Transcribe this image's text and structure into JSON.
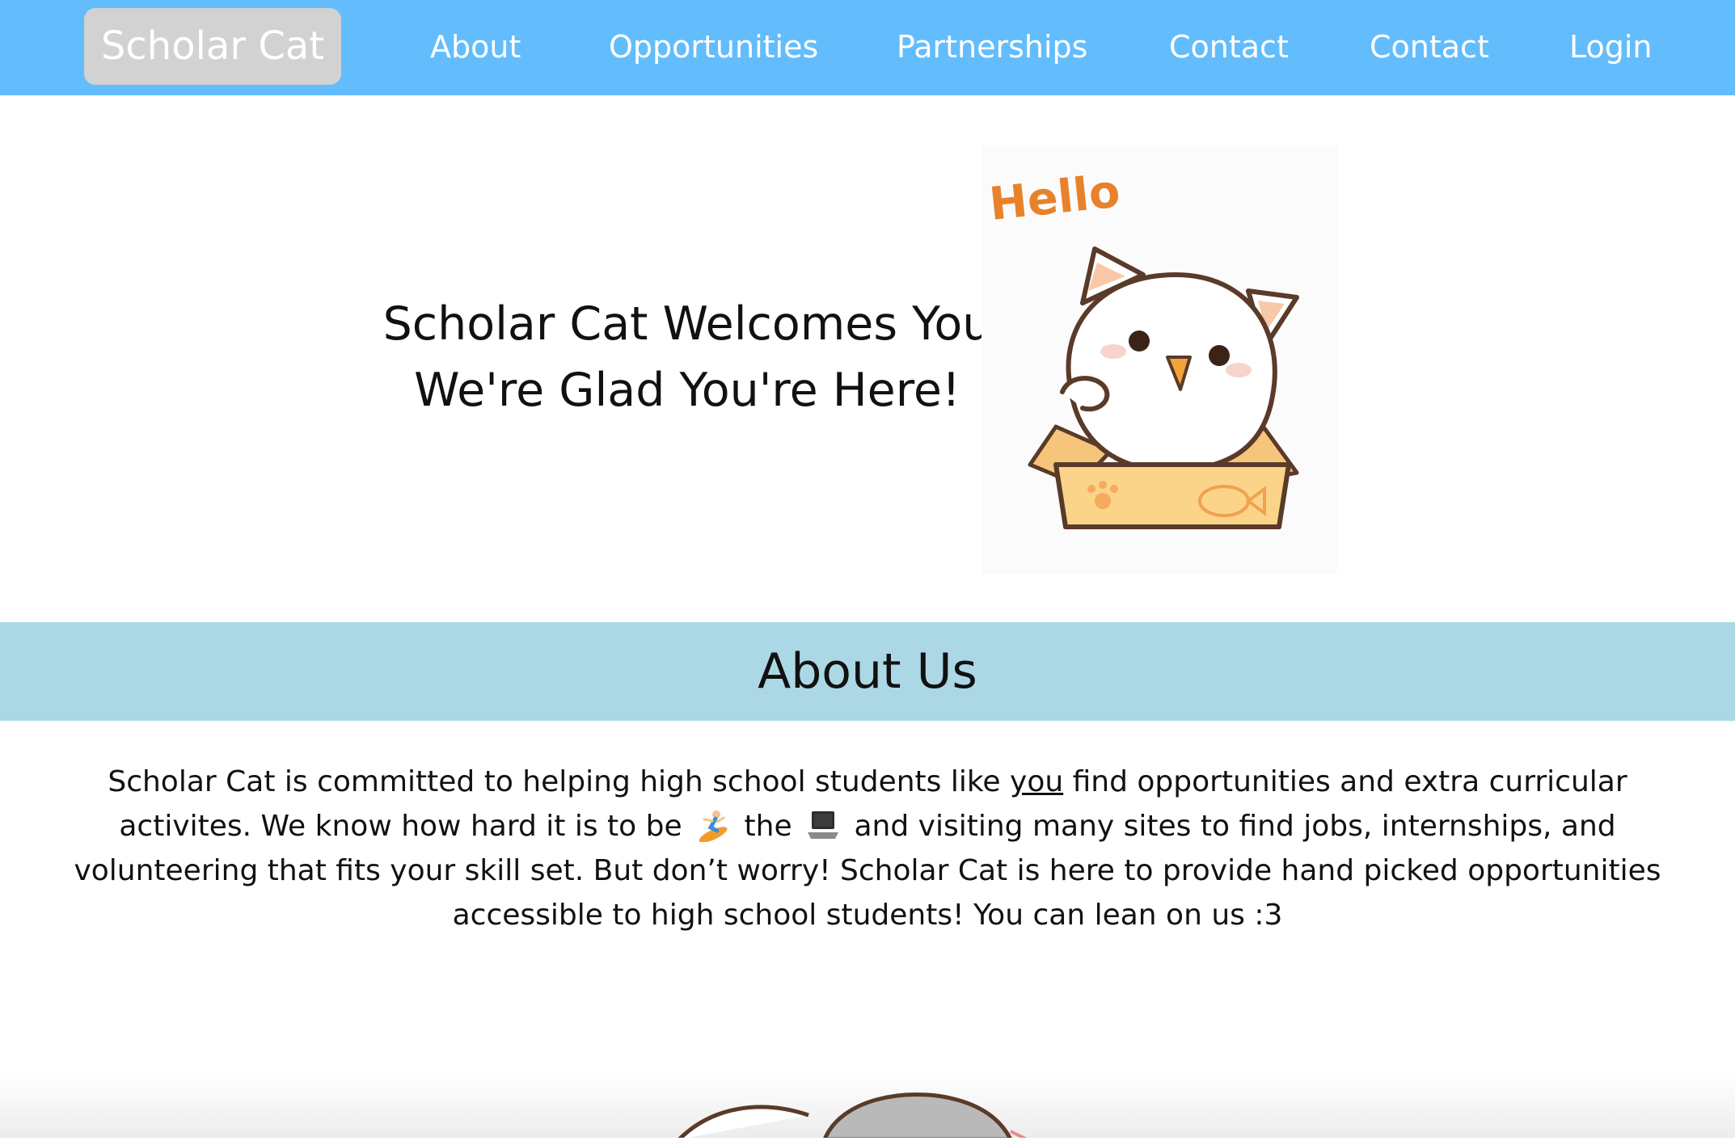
{
  "nav": {
    "brand": "Scholar Cat",
    "links": [
      "About",
      "Opportunities",
      "Partnerships",
      "Contact",
      "Contact",
      "Login"
    ]
  },
  "hero": {
    "line1": "Scholar Cat Welcomes You",
    "line2": "We're Glad You're Here!",
    "image_caption": "Hello",
    "image_icon": "cat-in-box-illustration"
  },
  "about": {
    "heading": "About Us",
    "text_1": "Scholar Cat is committed to helping high school students like ",
    "text_you": "you",
    "text_2": " find opportunities and extra curricular activites. We know how hard it is to be ",
    "emoji_1": "person-surfing-icon",
    "text_3": " the ",
    "emoji_2": "laptop-icon",
    "text_4": " and visiting many sites to find jobs, internships, and volunteering that fits your skill set. But don’t worry! Scholar Cat is here to provide hand picked opportunities accessible to high school students! You can lean on us :3"
  },
  "colors": {
    "navbar": "#63bdfc",
    "brand_bg": "#d2d2d2",
    "about_band": "#acd8e6"
  }
}
